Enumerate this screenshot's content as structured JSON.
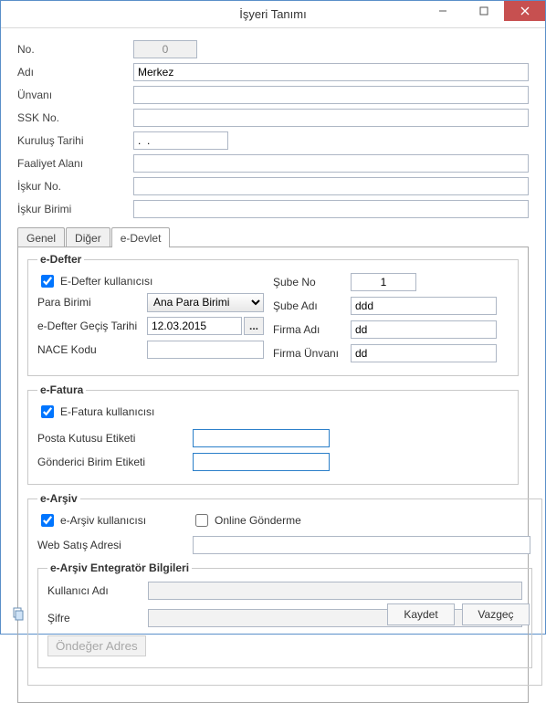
{
  "window": {
    "title": "İşyeri  Tanımı"
  },
  "basic": {
    "no_label": "No.",
    "no_value": "0",
    "adi_label": "Adı",
    "adi_value": "Merkez",
    "unvani_label": "Ünvanı",
    "unvani_value": "",
    "ssk_label": "SSK No.",
    "ssk_value": "",
    "kurulus_label": "Kuruluş Tarihi",
    "kurulus_value": ".  .",
    "faaliyet_label": "Faaliyet Alanı",
    "faaliyet_value": "",
    "iskurno_label": "İşkur No.",
    "iskurno_value": "",
    "iskurbirim_label": "İşkur Birimi",
    "iskurbirim_value": ""
  },
  "tabs": {
    "genel": "Genel",
    "diger": "Diğer",
    "edevlet": "e-Devlet"
  },
  "edefter": {
    "legend": "e-Defter",
    "kullanici_label": "E-Defter kullanıcısı",
    "kullanici_checked": true,
    "para_label": "Para Birimi",
    "para_value": "Ana Para Birimi",
    "gecis_label": "e-Defter Geçiş Tarihi",
    "gecis_value": "12.03.2015",
    "nace_label": "NACE Kodu",
    "nace_value": "",
    "sube_no_label": "Şube No",
    "sube_no_value": "1",
    "sube_adi_label": "Şube Adı",
    "sube_adi_value": "ddd",
    "firma_adi_label": "Firma Adı",
    "firma_adi_value": "dd",
    "firma_unvani_label": "Firma Ünvanı",
    "firma_unvani_value": "dd",
    "ellipsis": "..."
  },
  "efatura": {
    "legend": "e-Fatura",
    "kullanici_label": "E-Fatura kullanıcısı",
    "kullanici_checked": true,
    "posta_label": "Posta Kutusu Etiketi",
    "posta_value": "",
    "gonderici_label": "Gönderici Birim Etiketi",
    "gonderici_value": ""
  },
  "earsiv": {
    "legend": "e-Arşiv",
    "kullanici_label": "e-Arşiv kullanıcısı",
    "kullanici_checked": true,
    "online_label": "Online Gönderme",
    "online_checked": false,
    "web_label": "Web Satış Adresi",
    "web_value": "",
    "entegrator": {
      "legend": "e-Arşiv Entegratör Bilgileri",
      "kullanici_label": "Kullanıcı Adı",
      "kullanici_value": "",
      "sifre_label": "Şifre",
      "sifre_value": "",
      "ondeger_btn": "Öndeğer Adres"
    }
  },
  "footer": {
    "save": "Kaydet",
    "cancel": "Vazgeç"
  }
}
